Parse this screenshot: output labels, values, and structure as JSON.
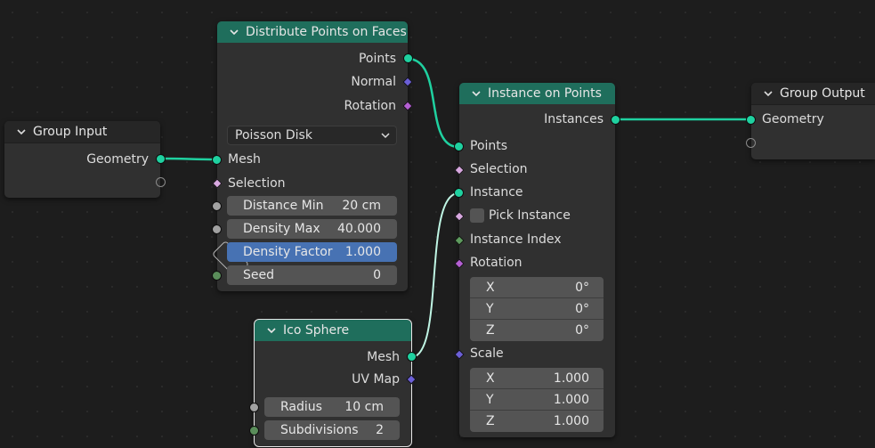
{
  "colors": {
    "geometry_socket": "#1fd1a0",
    "vector_socket": "#6b5fd6",
    "rotation_socket": "#b45fd3",
    "header_geometry": "#1f6e5c",
    "active_field": "#4772b3"
  },
  "group_input": {
    "title": "Group Input",
    "geometry": "Geometry"
  },
  "distribute": {
    "title": "Distribute Points on Faces",
    "outputs": {
      "points": "Points",
      "normal": "Normal",
      "rotation": "Rotation"
    },
    "mode": "Poisson Disk",
    "mesh": "Mesh",
    "selection": "Selection",
    "distance_min": {
      "label": "Distance Min",
      "value": "20 cm"
    },
    "density_max": {
      "label": "Density Max",
      "value": "40.000"
    },
    "density_factor": {
      "label": "Density Factor",
      "value": "1.000"
    },
    "seed": {
      "label": "Seed",
      "value": "0"
    }
  },
  "ico_sphere": {
    "title": "Ico Sphere",
    "mesh": "Mesh",
    "uv_map": "UV Map",
    "radius": {
      "label": "Radius",
      "value": "10 cm"
    },
    "subdivisions": {
      "label": "Subdivisions",
      "value": "2"
    }
  },
  "instance_on_points": {
    "title": "Instance on Points",
    "instances": "Instances",
    "points": "Points",
    "selection": "Selection",
    "instance": "Instance",
    "pick_instance": "Pick Instance",
    "instance_index": "Instance Index",
    "rotation": "Rotation",
    "rotation_values": [
      {
        "axis": "X",
        "value": "0°"
      },
      {
        "axis": "Y",
        "value": "0°"
      },
      {
        "axis": "Z",
        "value": "0°"
      }
    ],
    "scale": "Scale",
    "scale_values": [
      {
        "axis": "X",
        "value": "1.000"
      },
      {
        "axis": "Y",
        "value": "1.000"
      },
      {
        "axis": "Z",
        "value": "1.000"
      }
    ]
  },
  "group_output": {
    "title": "Group Output",
    "geometry": "Geometry"
  }
}
